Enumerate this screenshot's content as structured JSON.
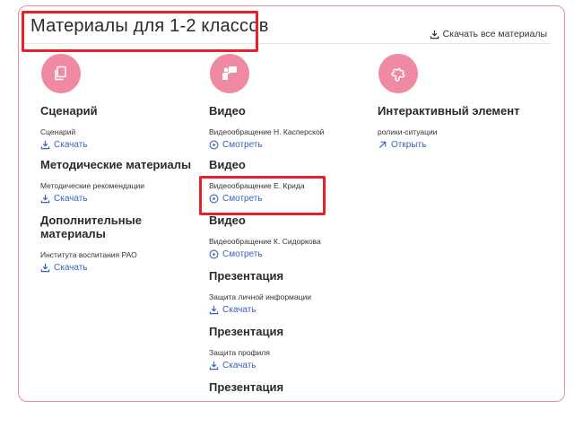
{
  "header": {
    "title": "Материалы для 1-2 классов",
    "download_all_label": "Скачать все материалы",
    "download_icon": "download-icon"
  },
  "columns": [
    {
      "icon": "document-copy-icon",
      "sections": [
        {
          "title": "Сценарий",
          "item": "Сценарий",
          "action": "Скачать",
          "action_icon": "download-icon"
        },
        {
          "title": "Методические материалы",
          "item": "Методические рекомендации",
          "action": "Скачать",
          "action_icon": "download-icon"
        },
        {
          "title": "Дополнительные материалы",
          "item": "Института воспитания РАО",
          "action": "Скачать",
          "action_icon": "download-icon"
        }
      ]
    },
    {
      "icon": "presenter-icon",
      "sections": [
        {
          "title": "Видео",
          "item": "Видеообращение Н. Касперской",
          "action": "Смотреть",
          "action_icon": "play-circle-icon"
        },
        {
          "title": "Видео",
          "item": "Видеообращение Е. Крида",
          "action": "Смотреть",
          "action_icon": "play-circle-icon"
        },
        {
          "title": "Видео",
          "item": "Видеообращение К. Сидоркова",
          "action": "Смотреть",
          "action_icon": "play-circle-icon"
        },
        {
          "title": "Презентация",
          "item": "Защита личной информации",
          "action": "Скачать",
          "action_icon": "download-icon"
        },
        {
          "title": "Презентация",
          "item": "Защита профиля",
          "action": "Скачать",
          "action_icon": "download-icon"
        },
        {
          "title": "Презентация",
          "item": "",
          "action": "",
          "action_icon": ""
        }
      ]
    },
    {
      "icon": "puzzle-icon",
      "sections": [
        {
          "title": "Интерактивный элемент",
          "item": "ролики-ситуации",
          "action": "Открыть",
          "action_icon": "arrow-up-right-icon"
        }
      ]
    }
  ],
  "colors": {
    "accent_pink": "#f08aa2",
    "link_blue": "#3b63b8",
    "highlight_red": "#e8202a"
  }
}
